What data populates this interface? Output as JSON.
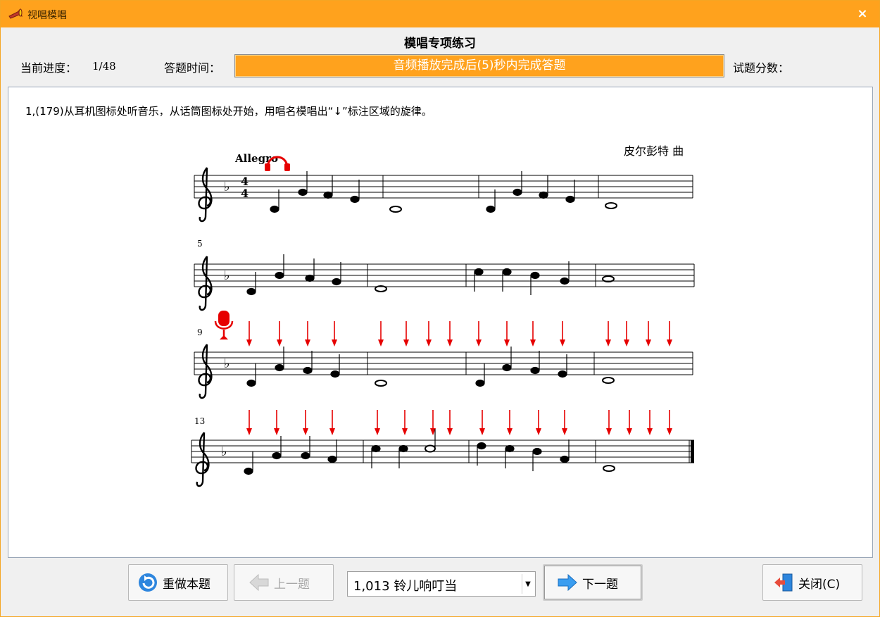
{
  "window": {
    "title": "视唱模唱",
    "close_glyph": "×",
    "icon": "trumpet-icon"
  },
  "heading": "模唱专项练习",
  "progress": {
    "label": "当前进度：",
    "value": "1/48"
  },
  "answer_time": {
    "label": "答题时间：",
    "text": "音频播放完成后(5)秒内完成答题"
  },
  "score": {
    "label": "试题分数："
  },
  "question": {
    "text": "1,(179)从耳机图标处听音乐，从话筒图标处开始，用唱名模唱出“↓”标注区域的旋律。",
    "sheet": {
      "tempo": "Allegro",
      "composer": "皮尔彭特 曲",
      "measure_numbers": [
        "5",
        "9",
        "13"
      ],
      "time_signature": [
        "4",
        "4"
      ]
    }
  },
  "buttons": {
    "redo": "重做本题",
    "prev": "上一题",
    "next": "下一题",
    "close": "关闭(C)"
  },
  "song_select": {
    "value": "1,013  铃儿响叮当"
  },
  "colors": {
    "accent": "#ffa21d",
    "arrow": "#e60000"
  }
}
